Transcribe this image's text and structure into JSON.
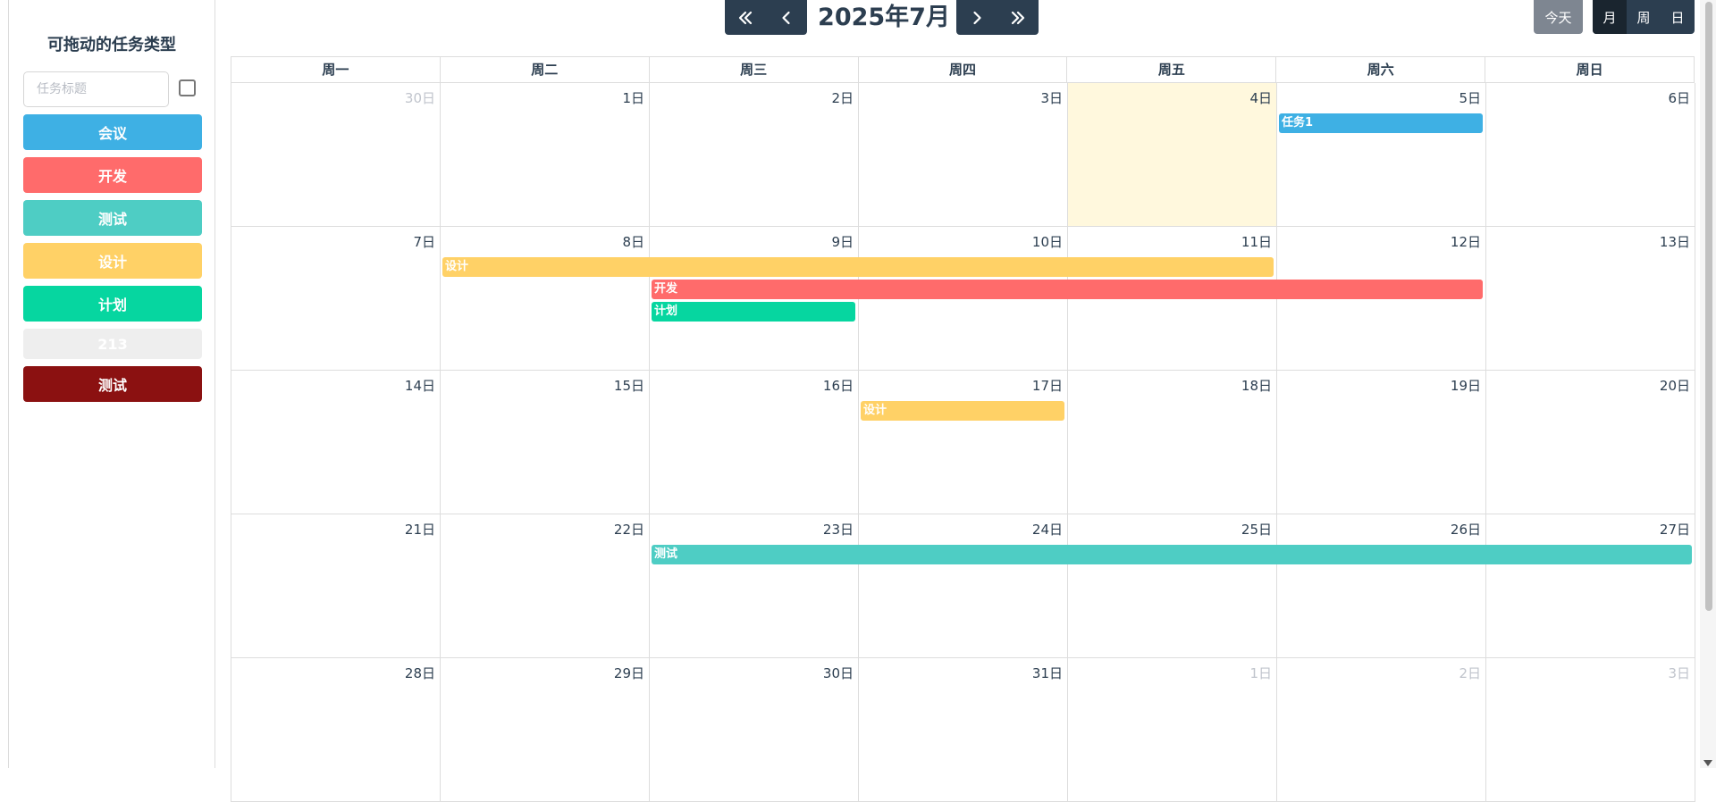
{
  "sidebar": {
    "title": "可拖动的任务类型",
    "input_placeholder": "任务标题",
    "types": [
      {
        "label": "会议",
        "color": "#3eb0e4"
      },
      {
        "label": "开发",
        "color": "#ff6b6b"
      },
      {
        "label": "测试",
        "color": "#4ecdc4"
      },
      {
        "label": "设计",
        "color": "#ffd166"
      },
      {
        "label": "计划",
        "color": "#06d6a0"
      },
      {
        "label": "213",
        "color": "#eeeeee"
      },
      {
        "label": "测试",
        "color": "#8b1111"
      }
    ]
  },
  "toolbar": {
    "title": "2025年7月",
    "today_label": "今天",
    "views": [
      "月",
      "周",
      "日"
    ],
    "active_view": "月"
  },
  "calendar": {
    "weekdays": [
      "周一",
      "周二",
      "周三",
      "周四",
      "周五",
      "周六",
      "周日"
    ],
    "weeks": [
      [
        "30日",
        "1日",
        "2日",
        "3日",
        "4日",
        "5日",
        "6日"
      ],
      [
        "7日",
        "8日",
        "9日",
        "10日",
        "11日",
        "12日",
        "13日"
      ],
      [
        "14日",
        "15日",
        "16日",
        "17日",
        "18日",
        "19日",
        "20日"
      ],
      [
        "21日",
        "22日",
        "23日",
        "24日",
        "25日",
        "26日",
        "27日"
      ],
      [
        "28日",
        "29日",
        "30日",
        "31日",
        "1日",
        "2日",
        "3日"
      ]
    ],
    "other_month": [
      [
        0
      ],
      [],
      [],
      [],
      [
        4,
        5,
        6
      ]
    ],
    "today": [
      0,
      4
    ],
    "events": [
      {
        "title": "任务1",
        "week": 0,
        "start": 5,
        "end": 5,
        "lane": 0,
        "color": "#3eb0e4"
      },
      {
        "title": "设计",
        "week": 1,
        "start": 1,
        "end": 4,
        "lane": 0,
        "color": "#ffd166"
      },
      {
        "title": "开发",
        "week": 1,
        "start": 2,
        "end": 5,
        "lane": 1,
        "color": "#ff6b6b"
      },
      {
        "title": "计划",
        "week": 1,
        "start": 2,
        "end": 2,
        "lane": 2,
        "color": "#06d6a0"
      },
      {
        "title": "设计",
        "week": 2,
        "start": 3,
        "end": 3,
        "lane": 0,
        "color": "#ffd166"
      },
      {
        "title": "测试",
        "week": 3,
        "start": 2,
        "end": 6,
        "lane": 0,
        "color": "#4ecdc4"
      }
    ]
  }
}
